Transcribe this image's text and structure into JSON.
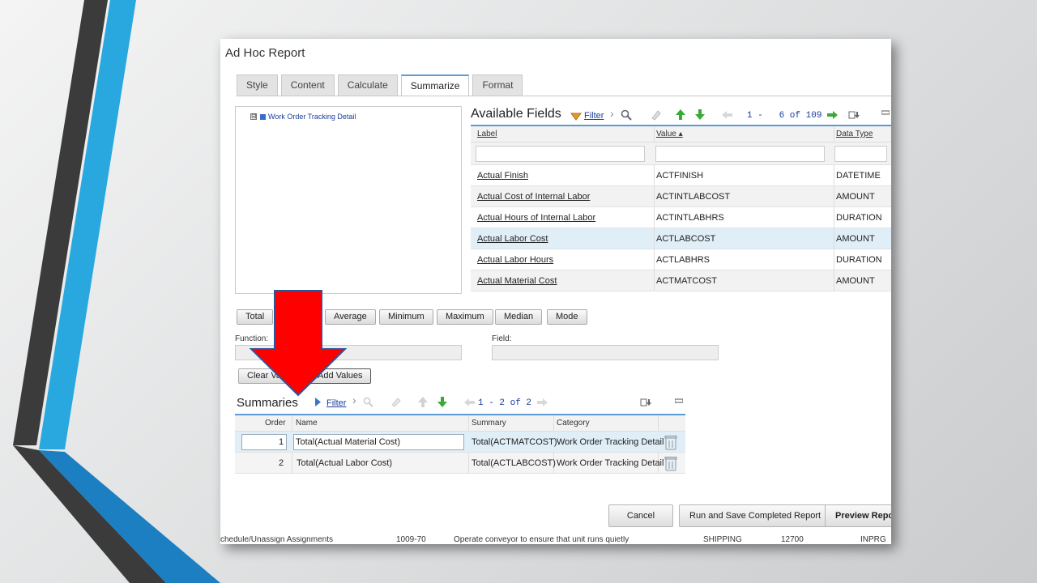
{
  "window": {
    "title": "Ad Hoc Report"
  },
  "tabs": [
    {
      "label": "Style"
    },
    {
      "label": "Content"
    },
    {
      "label": "Calculate"
    },
    {
      "label": "Summarize",
      "active": true
    },
    {
      "label": "Format"
    }
  ],
  "tree": {
    "node_label": "Work Order Tracking Detail",
    "expand_symbol": "⊟"
  },
  "available_fields": {
    "title": "Available Fields",
    "filter_label": "Filter",
    "pager": "1 -   6 of 109",
    "columns": {
      "label": "Label",
      "value": "Value",
      "data_type": "Data Type"
    },
    "rows": [
      {
        "label": "Actual Finish",
        "value": "ACTFINISH",
        "type": "DATETIME"
      },
      {
        "label": "Actual Cost of Internal Labor",
        "value": "ACTINTLABCOST",
        "type": "AMOUNT"
      },
      {
        "label": "Actual Hours of Internal Labor",
        "value": "ACTINTLABHRS",
        "type": "DURATION"
      },
      {
        "label": "Actual Labor Cost",
        "value": "ACTLABCOST",
        "type": "AMOUNT"
      },
      {
        "label": "Actual Labor Hours",
        "value": "ACTLABHRS",
        "type": "DURATION"
      },
      {
        "label": "Actual Material Cost",
        "value": "ACTMATCOST",
        "type": "AMOUNT"
      }
    ]
  },
  "functions": {
    "total": "Total",
    "average": "Average",
    "minimum": "Minimum",
    "maximum": "Maximum",
    "median": "Median",
    "mode": "Mode"
  },
  "fields": {
    "function_label": "Function:",
    "field_label": "Field:",
    "function_value": "",
    "field_value": ""
  },
  "actions": {
    "clear_values": "Clear Values",
    "add_values": "Add Values"
  },
  "summaries": {
    "title": "Summaries",
    "filter_label": "Filter",
    "pager": "1 - 2 of 2",
    "columns": {
      "order": "Order",
      "name": "Name",
      "summary": "Summary",
      "category": "Category"
    },
    "rows": [
      {
        "order": "1",
        "name": "Total(Actual Material Cost)",
        "summary": "Total(ACTMATCOST)",
        "category": "Work Order Tracking Detail"
      },
      {
        "order": "2",
        "name": "Total(Actual Labor Cost)",
        "summary": "Total(ACTLABCOST)",
        "category": "Work Order Tracking Detail"
      }
    ]
  },
  "bottom_buttons": {
    "cancel": "Cancel",
    "run_save": "Run and Save Completed Report",
    "preview": "Preview Report"
  },
  "background_strip": {
    "c1": "chedule/Unassign Assignments",
    "c2": "1009-70",
    "c3": "Operate conveyor to ensure that unit runs quietly",
    "c4": "SHIPPING",
    "c5": "12700",
    "c6": "INPRG"
  },
  "colors": {
    "accent_blue": "#29a8e0",
    "dark_stripe": "#3b3b3b",
    "arrow_red": "#ff0000",
    "link": "#1a3d9c",
    "selected_row": "#dfeef7"
  },
  "annotation": {
    "arrow_icon": "red-down-arrow-icon"
  }
}
